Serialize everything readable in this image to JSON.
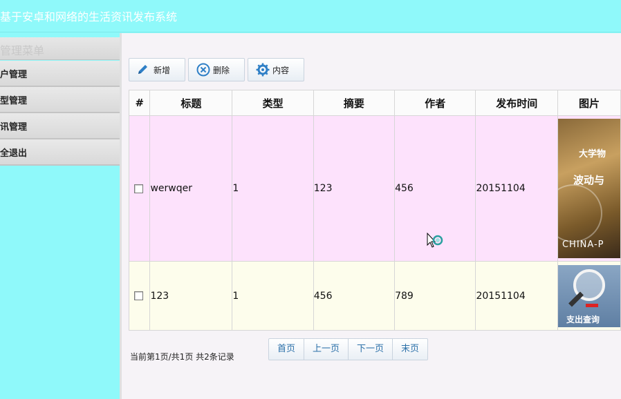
{
  "header": {
    "title": "基于安卓和网络的生活资讯发布系统"
  },
  "sidebar": {
    "menu_title": "管理菜单",
    "items": [
      {
        "label": "户管理"
      },
      {
        "label": "型管理"
      },
      {
        "label": "讯管理"
      },
      {
        "label": "全退出"
      }
    ]
  },
  "toolbar": {
    "add_label": "新增",
    "delete_label": "删除",
    "content_label": "内容"
  },
  "table": {
    "columns": [
      "#",
      "标题",
      "类型",
      "摘要",
      "作者",
      "发布时间",
      "图片"
    ],
    "rows": [
      {
        "title": "werwqer",
        "type": "1",
        "summary": "123",
        "author": "456",
        "time": "20151104",
        "image": {
          "line1": "大学物",
          "line2": "波动与",
          "line3": "CHINA-P"
        }
      },
      {
        "title": "123",
        "type": "1",
        "summary": "456",
        "author": "789",
        "time": "20151104",
        "image": {
          "text": "支出查询"
        }
      }
    ]
  },
  "pager": {
    "info": "当前第1页/共1页  共2条记录",
    "first": "首页",
    "prev": "上一页",
    "next": "下一页",
    "last": "末页"
  },
  "colors": {
    "header_bg": "#8ff9fa",
    "row1_bg": "#fde2fc",
    "row2_bg": "#fdfdec",
    "link": "#2a6fa8",
    "icon_blue": "#2e7fc6"
  },
  "icons": {
    "add": "pencil-icon",
    "delete": "circle-x-icon",
    "content": "gear-icon"
  }
}
